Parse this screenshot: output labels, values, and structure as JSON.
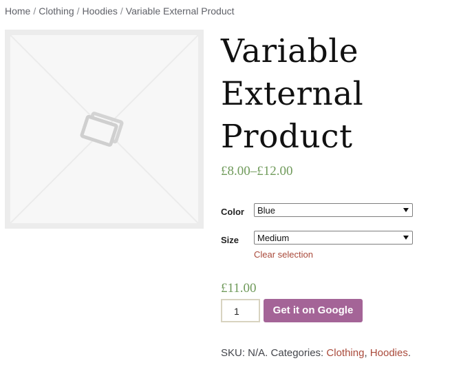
{
  "breadcrumb": {
    "home": "Home",
    "separator": "/",
    "category": "Clothing",
    "subcategory": "Hoodies",
    "current": "Variable External Product"
  },
  "product": {
    "title": "Variable External Product",
    "price_range": "£8.00–£12.00",
    "attributes": {
      "color_label": "Color",
      "color_value": "Blue",
      "size_label": "Size",
      "size_value": "Medium"
    },
    "clear_selection": "Clear selection",
    "variation_price": "£11.00",
    "quantity": "1",
    "button_label": "Get it on Google",
    "meta": {
      "sku_text": "SKU: N/A. Categories: ",
      "cat1": "Clothing",
      "comma": ", ",
      "cat2": "Hoodies",
      "end": "."
    }
  },
  "colors": {
    "button": "#a46497",
    "price": "#6f9a5a",
    "link": "#a9493a"
  },
  "icons": {
    "placeholder": "image-placeholder-icon",
    "dropdown": "chevron-down-icon"
  }
}
